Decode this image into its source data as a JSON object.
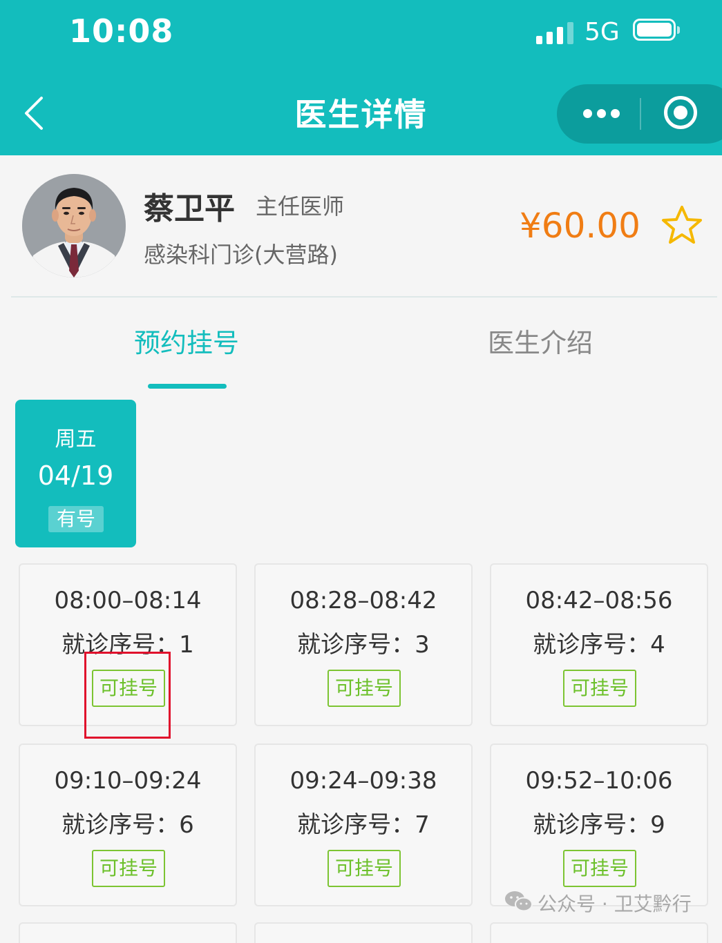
{
  "status_bar": {
    "time": "10:08",
    "network": "5G",
    "signal_icon": "signal-bars-icon",
    "battery_icon": "battery-icon"
  },
  "nav": {
    "title": "医生详情",
    "back_icon": "chevron-left-icon",
    "more_icon": "more-dots-icon",
    "close_icon": "target-circle-icon"
  },
  "doctor": {
    "name": "蔡卫平",
    "title": "主任医师",
    "department": "感染科门诊(大营路)",
    "price": "¥60.00",
    "favorite_icon": "star-outline-icon"
  },
  "tabs": [
    {
      "label": "预约挂号",
      "active": true
    },
    {
      "label": "医生介绍",
      "active": false
    }
  ],
  "date": {
    "weekday": "周五",
    "day": "04/19",
    "status": "有号"
  },
  "slots": [
    {
      "time": "08:00–08:14",
      "seq_label": "就诊序号：",
      "seq": "1",
      "action": "可挂号"
    },
    {
      "time": "08:28–08:42",
      "seq_label": "就诊序号：",
      "seq": "3",
      "action": "可挂号"
    },
    {
      "time": "08:42–08:56",
      "seq_label": "就诊序号：",
      "seq": "4",
      "action": "可挂号"
    },
    {
      "time": "09:10–09:24",
      "seq_label": "就诊序号：",
      "seq": "6",
      "action": "可挂号"
    },
    {
      "time": "09:24–09:38",
      "seq_label": "就诊序号：",
      "seq": "7",
      "action": "可挂号"
    },
    {
      "time": "09:52–10:06",
      "seq_label": "就诊序号：",
      "seq": "9",
      "action": "可挂号"
    }
  ],
  "watermark": {
    "text": "公众号 · 卫艾黔行",
    "icon": "wechat-icon"
  },
  "colors": {
    "primary": "#13bdbd",
    "price": "#f07d14",
    "star": "#f5b800",
    "available": "#6cc02a",
    "highlight": "#e0102c"
  }
}
